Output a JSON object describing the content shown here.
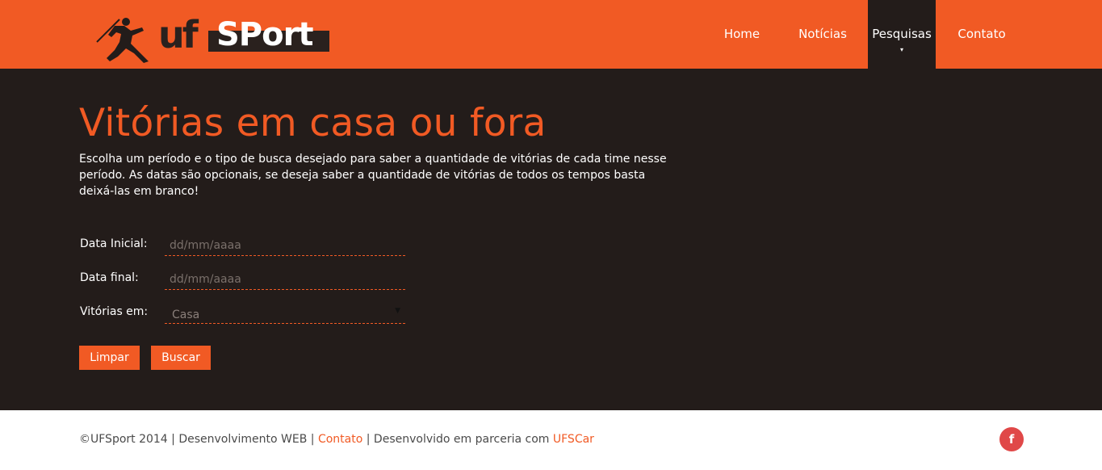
{
  "brand": {
    "logo_text_uf": "uf",
    "logo_text_sport": "SPort",
    "brand_color": "#f15a24",
    "dark_color": "#231c1a"
  },
  "nav": {
    "items": [
      {
        "label": "Home"
      },
      {
        "label": "Notícias"
      },
      {
        "label": "Pesquisas",
        "active": true
      },
      {
        "label": "Contato"
      }
    ],
    "active_caret": "▾"
  },
  "page": {
    "title": "Vitórias em casa ou fora",
    "intro": "Escolha um período e o tipo de busca desejado para saber a quantidade de vitórias de cada time nesse período. As datas são opcionais, se deseja saber a quantidade de vitórias de todos os tempos basta deixá-las em branco!"
  },
  "form": {
    "start_date": {
      "label": "Data Inicial:",
      "placeholder": "dd/mm/aaaa",
      "value": ""
    },
    "end_date": {
      "label": "Data final:",
      "placeholder": "dd/mm/aaaa",
      "value": ""
    },
    "wins_in": {
      "label": "Vitórias em:",
      "selected": "Casa"
    },
    "clear_label": "Limpar",
    "search_label": "Buscar"
  },
  "footer": {
    "copyright": "©UFSport 2014 | Desenvolvimento WEB | ",
    "contact_link": "Contato",
    "partner_text": " | Desenvolvido em parceria com ",
    "partner_link": "UFSCar",
    "facebook_icon": "facebook-icon",
    "facebook_glyph": "f"
  }
}
